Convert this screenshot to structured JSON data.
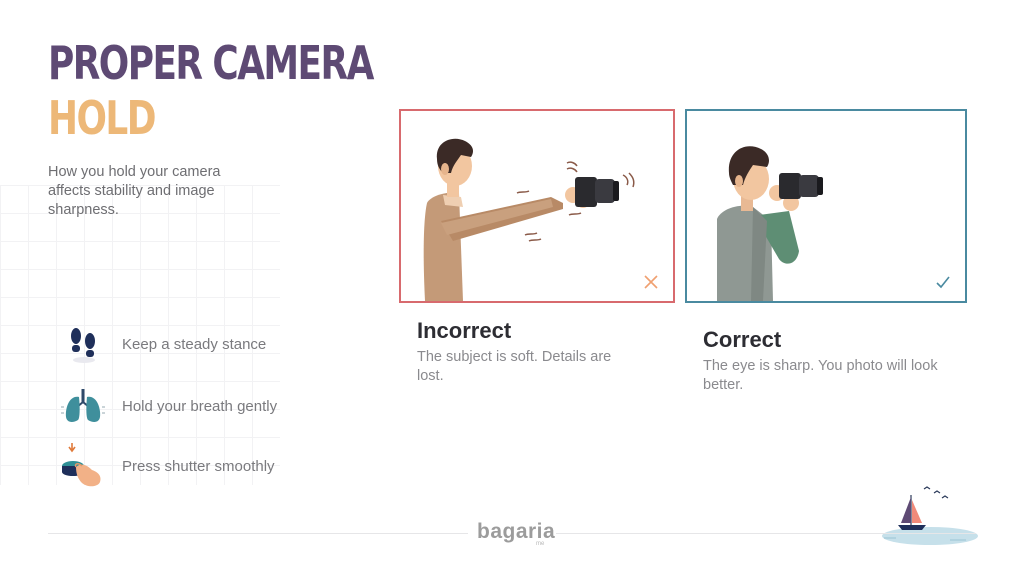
{
  "title": {
    "line1": "PROPER CAMERA",
    "line2": "HOLD"
  },
  "intro": "How you hold your camera affects stability and image sharpness.",
  "tips": [
    {
      "label": "Keep a steady stance",
      "icon": "footprints-icon"
    },
    {
      "label": "Hold your breath gently",
      "icon": "lungs-icon"
    },
    {
      "label": "Press shutter smoothly",
      "icon": "shutter-press-icon"
    }
  ],
  "examples": [
    {
      "title": "Incorrect",
      "description": "The subject is soft. Details are lost.",
      "mark": "cross-icon",
      "border_color": "#d86a6e"
    },
    {
      "title": "Correct",
      "description": "The eye is sharp. You photo will look better.",
      "mark": "check-icon",
      "border_color": "#4a8aa0"
    }
  ],
  "footer": {
    "brand": "bagaria",
    "brand_sub": "me"
  },
  "colors": {
    "title_primary": "#5e4a74",
    "title_accent": "#edb878"
  }
}
